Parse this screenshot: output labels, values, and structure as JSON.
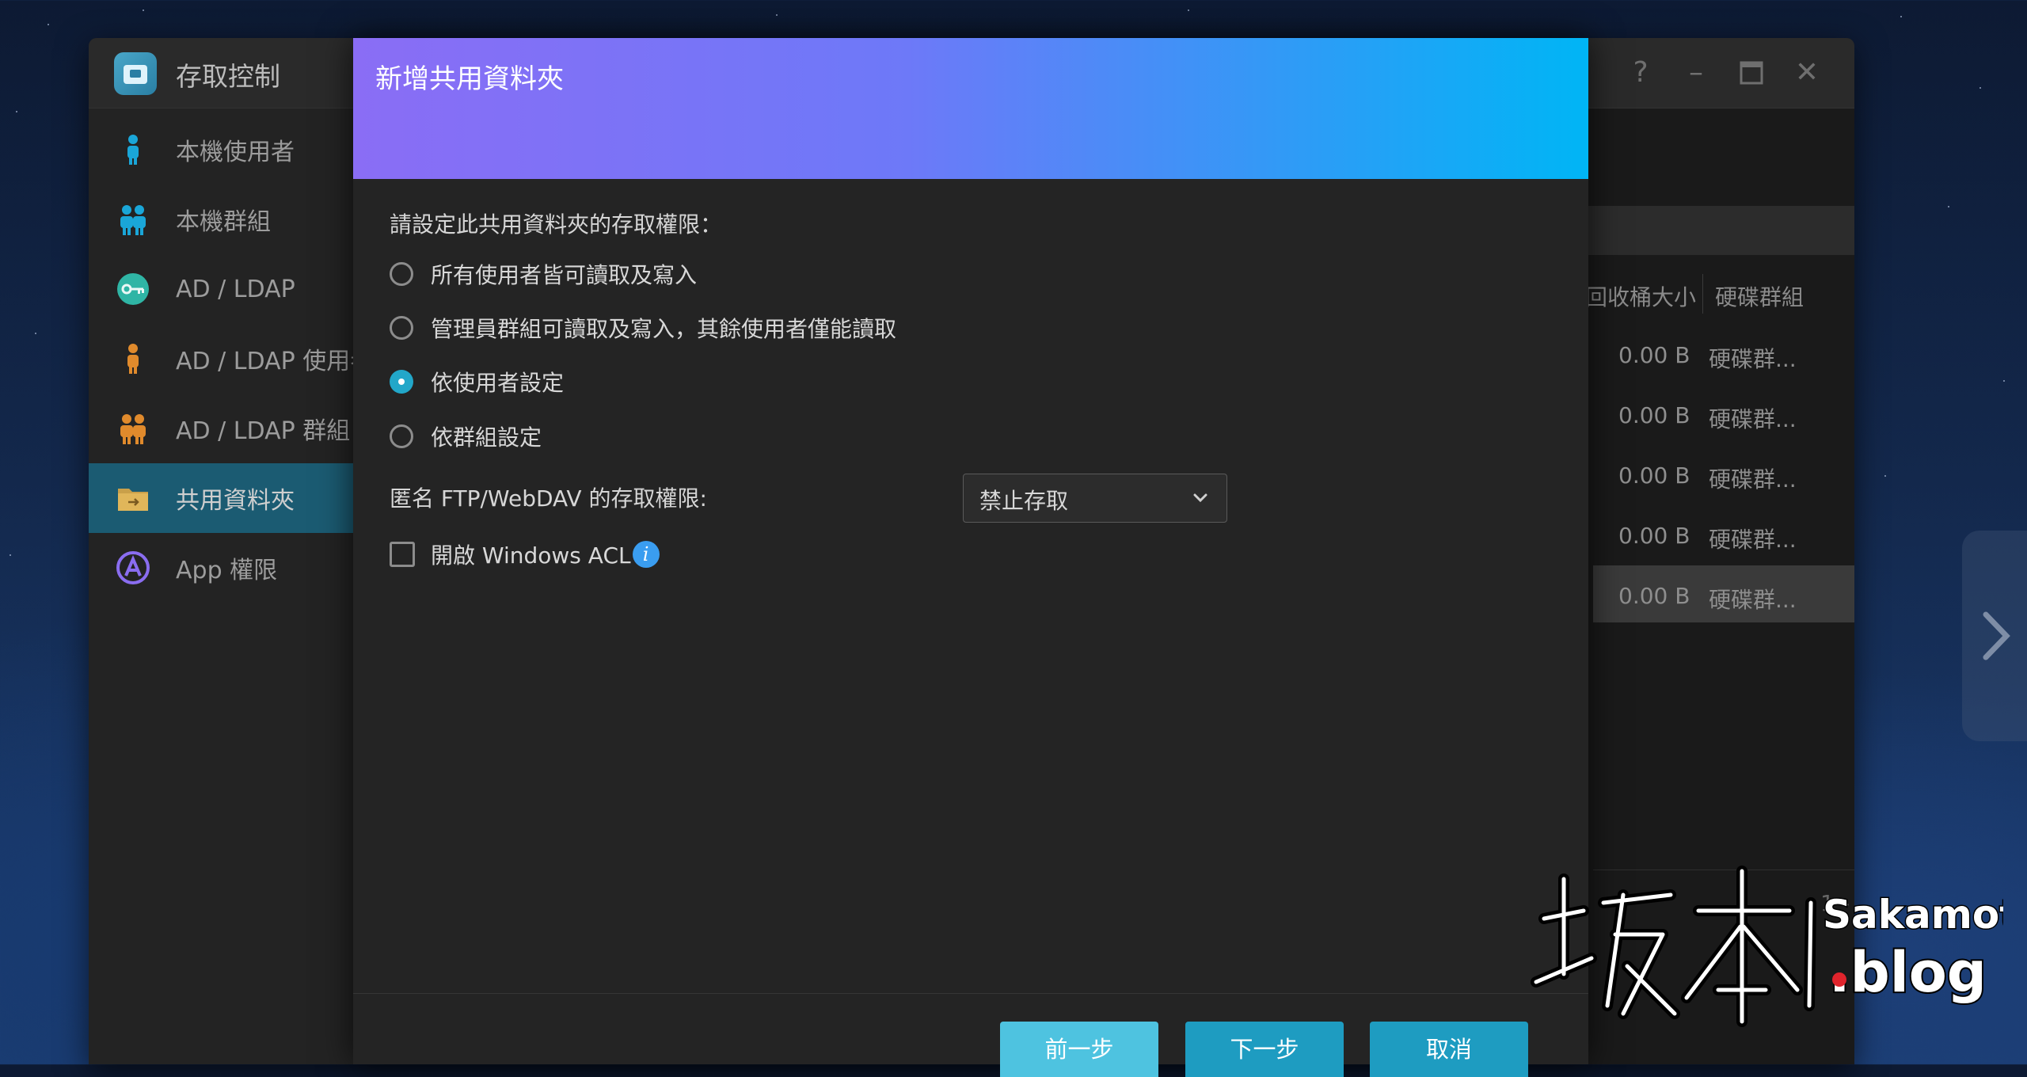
{
  "window": {
    "title": "存取控制",
    "controls": [
      "help-icon",
      "minimize-icon",
      "maximize-icon",
      "close-icon"
    ]
  },
  "sidebar": {
    "items": [
      {
        "label": "本機使用者",
        "icon": "user-icon",
        "color": "#1aa6d8"
      },
      {
        "label": "本機群組",
        "icon": "users-icon",
        "color": "#1aa6d8"
      },
      {
        "label": "AD / LDAP",
        "icon": "key-icon",
        "color": "#2fb5a5"
      },
      {
        "label": "AD / LDAP 使用者",
        "icon": "user-icon",
        "color": "#e08a2c"
      },
      {
        "label": "AD / LDAP 群組",
        "icon": "users-icon",
        "color": "#e08a2c"
      },
      {
        "label": "共用資料夾",
        "icon": "folder-icon",
        "color": "#c9a04a",
        "active": true
      },
      {
        "label": "App 權限",
        "icon": "app-icon",
        "color": "#8a6df0"
      }
    ]
  },
  "table": {
    "headers": [
      "回收桶大小",
      "硬碟群組"
    ],
    "rows": [
      [
        "0.00 B",
        "硬碟群..."
      ],
      [
        "0.00 B",
        "硬碟群..."
      ],
      [
        "0.00 B",
        "硬碟群..."
      ],
      [
        "0.00 B",
        "硬碟群..."
      ],
      [
        "0.00 B",
        "硬碟群..."
      ]
    ],
    "pager": "1 -"
  },
  "dialog": {
    "title": "新增共用資料夾",
    "prompt": "請設定此共用資料夾的存取權限：",
    "options": [
      {
        "label": "所有使用者皆可讀取及寫入",
        "checked": false
      },
      {
        "label": "管理員群組可讀取及寫入，其餘使用者僅能讀取",
        "checked": false
      },
      {
        "label": "依使用者設定",
        "checked": true
      },
      {
        "label": "依群組設定",
        "checked": false
      }
    ],
    "ftp_label": "匿名 FTP/WebDAV 的存取權限:",
    "ftp_value": "禁止存取",
    "acl_label": "開啟 Windows ACL",
    "acl_checked": false,
    "buttons": {
      "prev": "前一步",
      "next": "下一步",
      "cancel": "取消"
    }
  },
  "watermark": {
    "cjk": "坂本",
    "latin_top": "Sakamoto",
    "latin_bottom": ".blog"
  }
}
